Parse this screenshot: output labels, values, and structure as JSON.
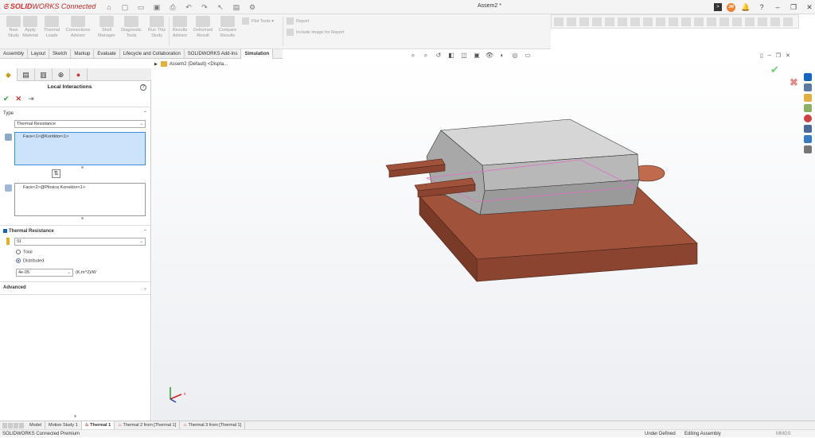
{
  "app": {
    "brand_prefix": "SOLID",
    "brand_suffix": "WORKS Connected",
    "doc_title": "Assem2 *",
    "user_initials": "JM"
  },
  "ribbon": {
    "commands": [
      {
        "label": "New\nStudy"
      },
      {
        "label": "Apply\nMaterial"
      },
      {
        "label": "Thermal\nLoads"
      },
      {
        "label": "Connections\nAdvisor"
      },
      {
        "label": "Shell\nManager"
      },
      {
        "label": "Diagnostic\nTools"
      },
      {
        "label": "Run This\nStudy"
      },
      {
        "label": "Results\nAdvisor"
      },
      {
        "label": "Deformed\nResult"
      },
      {
        "label": "Compare\nResults"
      }
    ],
    "plot_tools": "Plot Tools",
    "report": "Report",
    "include_image": "Include Image for Report"
  },
  "tabs": [
    {
      "label": "Assembly"
    },
    {
      "label": "Layout"
    },
    {
      "label": "Sketch"
    },
    {
      "label": "Markup"
    },
    {
      "label": "Evaluate"
    },
    {
      "label": "Lifecycle and Collaboration"
    },
    {
      "label": "SOLIDWORKS Add-Ins"
    },
    {
      "label": "Simulation",
      "active": true
    }
  ],
  "property_manager": {
    "title": "Local Interactions",
    "type_section": "Type",
    "type_value": "Thermal Resistance",
    "face1": "Face<1>@Kontktor<1>",
    "face2": "Face<2>@Plosica Konektor<1>",
    "thermal_section": "Thermal Resistance",
    "unit_system": "SI",
    "radio_total": "Total",
    "radio_distributed": "Distributed",
    "value": "4e-05",
    "unit": "(K.m^2)/W",
    "advanced": "Advanced"
  },
  "tree": {
    "root": "Assem2 (Default) <Displa..."
  },
  "bottom_tabs": [
    {
      "label": "Model"
    },
    {
      "label": "Motion Study 1"
    },
    {
      "label": "Thermal 1",
      "active": true
    },
    {
      "label": "Thermal 2 from [Thermal 1]"
    },
    {
      "label": "Thermal 3 from [Thermal 1]"
    }
  ],
  "status": {
    "product": "SOLIDWORKS Connected Premium",
    "definition": "Under Defined",
    "mode": "Editing Assembly",
    "units": "MMGS"
  },
  "colors": {
    "copper": "#a0523a",
    "copper_dark": "#7a3a28",
    "body_top": "#d9d9d9",
    "body_side": "#9a9a9a",
    "selection_blue": "#cde3fb",
    "face2_pink": "#ec7aa8"
  }
}
